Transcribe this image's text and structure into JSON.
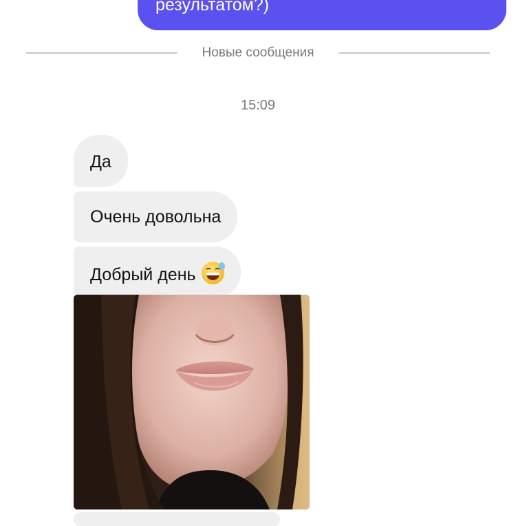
{
  "outgoing_message": {
    "text": "результатом?)",
    "color": "#5b50f0"
  },
  "divider": {
    "label": "Новые сообщения"
  },
  "timestamp": "15:09",
  "incoming_messages": [
    {
      "text": "Да"
    },
    {
      "text": "Очень довольна"
    },
    {
      "text": "Добрый день",
      "emoji": "grinning-face-with-sweat"
    }
  ],
  "photo": {
    "subject": "face-closeup"
  },
  "colors": {
    "incoming_bubble": "#efefef",
    "muted_text": "#7a7a7a"
  }
}
